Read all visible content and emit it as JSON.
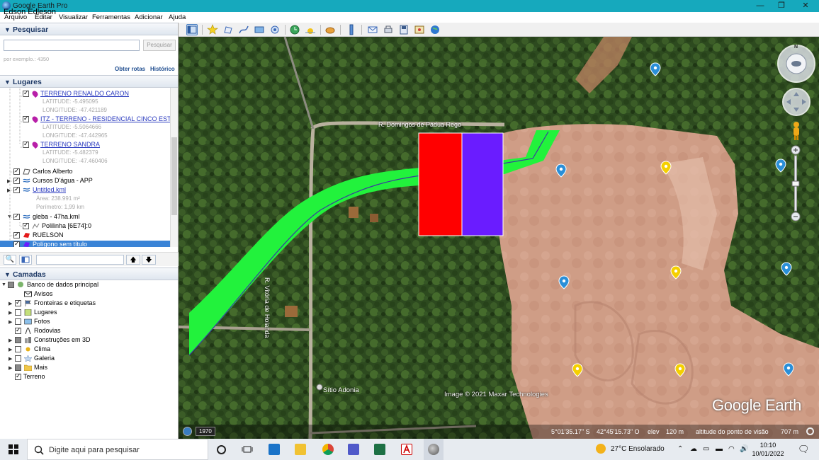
{
  "window": {
    "title": "Google Earth Pro",
    "user_overlay": "Edson Edleson",
    "controls": [
      "—",
      "❐",
      "✕"
    ]
  },
  "menu": [
    "Arquivo",
    "Editar",
    "Visualizar",
    "Ferramentas",
    "Adicionar",
    "Ajuda"
  ],
  "search": {
    "header": "Pesquisar",
    "placeholder": "",
    "button": "Pesquisar",
    "hint": "por exemplo.: 4350",
    "links": [
      "Obter rotas",
      "Histórico"
    ]
  },
  "places": {
    "header": "Lugares",
    "items": [
      {
        "name": "TERRENO RENALDO CARON",
        "lat": "LATITUDE: -5.495095",
        "lon": "LONGITUDE: -47.421189"
      },
      {
        "name": "ITZ - TERRENO - RESIDENCIAL CINCO ESTREL",
        "lat": "LATITUDE: -5.5064666",
        "lon": "LONGITUDE: -47.442965"
      },
      {
        "name": "TERRENO SANDRA",
        "lat": "LATITUDE: -5.482379",
        "lon": "LONGITUDE: -47.460406"
      }
    ],
    "carlos": "Carlos Alberto",
    "cursos": "Cursos D'água - APP",
    "untitled": "Untitled.kml",
    "area": "Área: 238.991 m²",
    "perimetro": "Perímetro: 1,99 km",
    "gleba": "gleba - 47ha.kml",
    "polilinha": "Polilinha [6E74]:0",
    "ruelson": "RUELSON",
    "poligono": "Polígono sem título"
  },
  "layers": {
    "header": "Camadas",
    "root": "Banco de dados principal",
    "items": [
      "Avisos",
      "Fronteiras e etiquetas",
      "Lugares",
      "Fotos",
      "Rodovias",
      "Construções em 3D",
      "Clima",
      "Galeria",
      "Mais"
    ],
    "terreno": "Terreno"
  },
  "map": {
    "road_top": "R. Domingos de Pádua Rego",
    "road_left": "R. Vitória de Holanda",
    "place_label": "Sítio Adonia",
    "copyright": "Image © 2021 Maxar Technologies",
    "brand": "Google Earth",
    "year": "1970",
    "status": {
      "lat": "5°01'35.17\" S",
      "lon": "42°45'15.73\" O",
      "elev_label": "elev",
      "elev": "120 m",
      "alt_label": "altitude do ponto de visão",
      "alt": "707 m"
    }
  },
  "taskbar": {
    "search_placeholder": "Digite aqui para pesquisar",
    "weather": "27°C  Ensolarado",
    "time": "10:10",
    "date": "10/01/2022"
  },
  "colors": {
    "accent": "#16a9bd",
    "polygon_red": "#ff0000",
    "polygon_blue": "#6a1cff",
    "path_green": "#22f23c",
    "pin_blue": "#2a8fd8",
    "pin_yellow": "#f5d000"
  }
}
